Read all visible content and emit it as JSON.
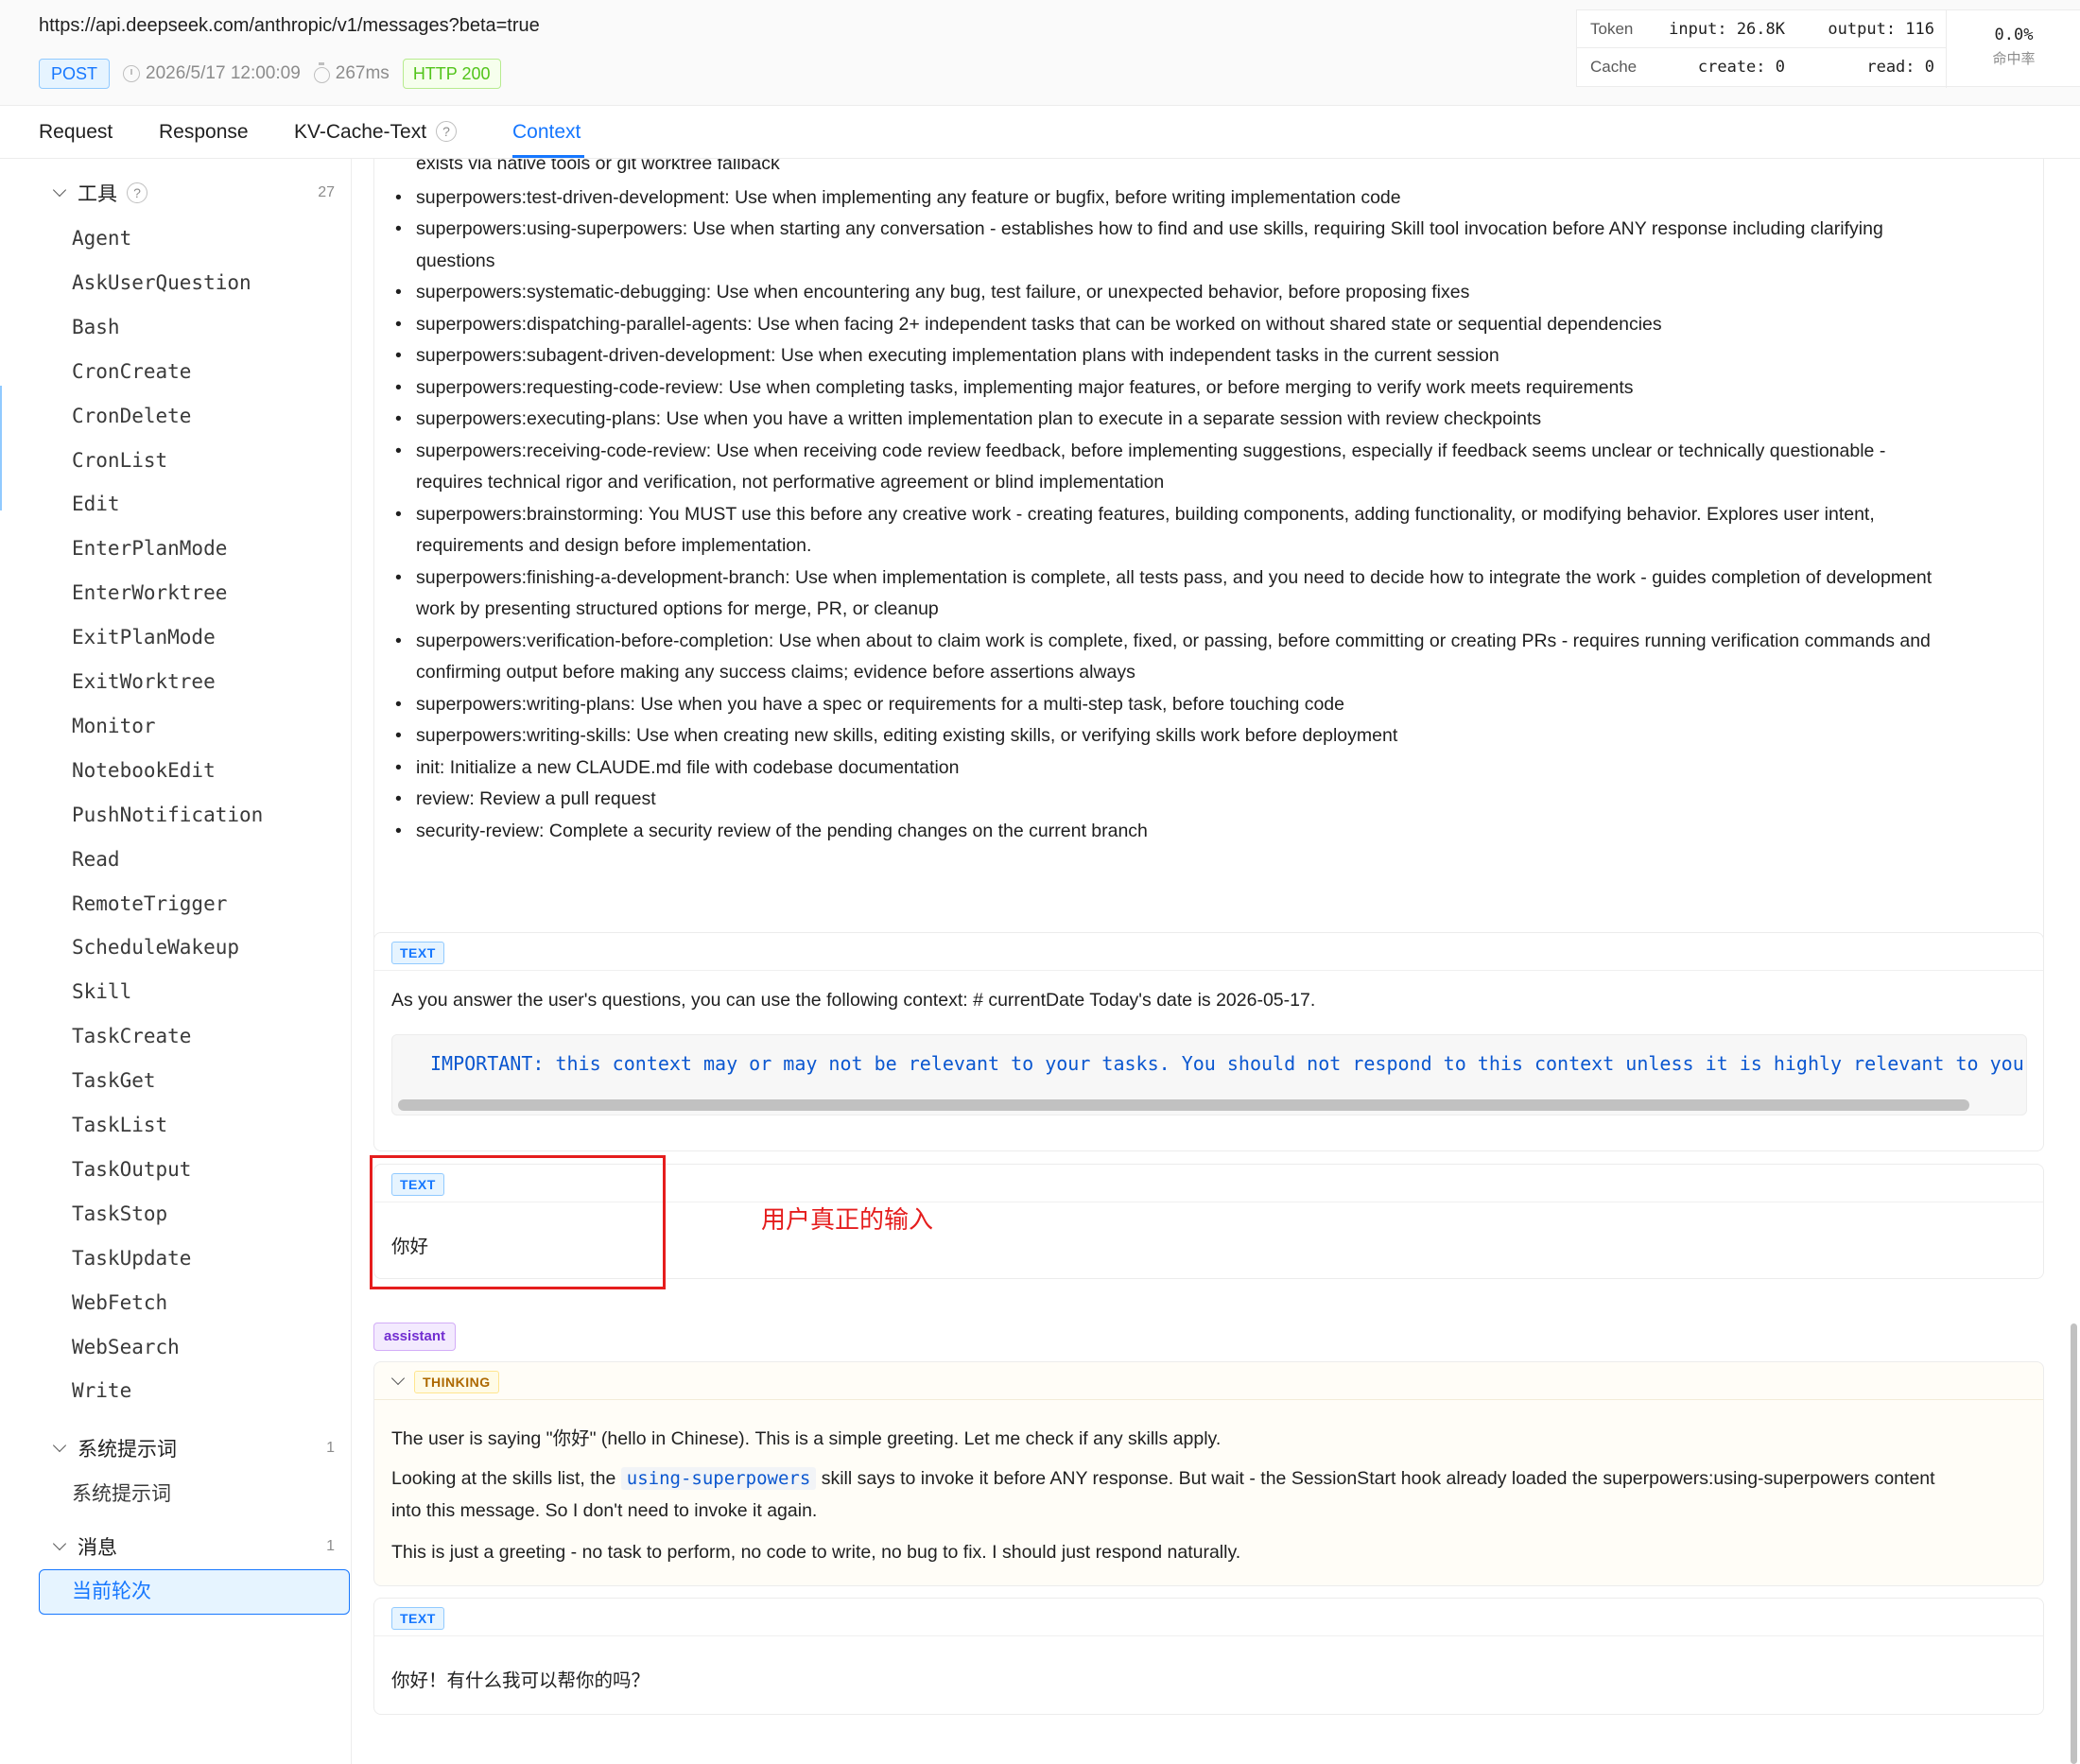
{
  "request": {
    "url": "https://api.deepseek.com/anthropic/v1/messages?beta=true",
    "method": "POST",
    "time": "2026/5/17 12:00:09",
    "duration": "267ms",
    "status": "HTTP 200"
  },
  "stats": {
    "token_label": "Token",
    "input": "input: 26.8K",
    "output": "output: 116",
    "cache_label": "Cache",
    "create": "create: 0",
    "read": "read: 0",
    "hit_rate": "0.0%",
    "hit_label": "命中率"
  },
  "tabs": [
    {
      "label": "Request"
    },
    {
      "label": "Response"
    },
    {
      "label": "KV-Cache-Text",
      "help": "?"
    },
    {
      "label": "Context",
      "active": true
    }
  ],
  "sidebar": {
    "tools": {
      "label": "工具",
      "help": "?",
      "count": "27",
      "items": [
        "Agent",
        "AskUserQuestion",
        "Bash",
        "CronCreate",
        "CronDelete",
        "CronList",
        "Edit",
        "EnterPlanMode",
        "EnterWorktree",
        "ExitPlanMode",
        "ExitWorktree",
        "Monitor",
        "NotebookEdit",
        "PushNotification",
        "Read",
        "RemoteTrigger",
        "ScheduleWakeup",
        "Skill",
        "TaskCreate",
        "TaskGet",
        "TaskList",
        "TaskOutput",
        "TaskStop",
        "TaskUpdate",
        "WebFetch",
        "WebSearch",
        "Write"
      ]
    },
    "system": {
      "label": "系统提示词",
      "count": "1",
      "items": [
        "系统提示词"
      ]
    },
    "messages": {
      "label": "消息",
      "count": "1",
      "items": [
        "当前轮次"
      ]
    }
  },
  "skills_list": [
    {
      "text": "exists via native tools or git worktree fallback",
      "continuation": true
    },
    {
      "text": "superpowers:test-driven-development: Use when implementing any feature or bugfix, before writing implementation code"
    },
    {
      "text": "superpowers:using-superpowers: Use when starting any conversation - establishes how to find and use skills, requiring Skill tool invocation before ANY response including clarifying"
    },
    {
      "text": "questions",
      "continuation": true
    },
    {
      "text": "superpowers:systematic-debugging: Use when encountering any bug, test failure, or unexpected behavior, before proposing fixes"
    },
    {
      "text": "superpowers:dispatching-parallel-agents: Use when facing 2+ independent tasks that can be worked on without shared state or sequential dependencies"
    },
    {
      "text": "superpowers:subagent-driven-development: Use when executing implementation plans with independent tasks in the current session"
    },
    {
      "text": "superpowers:requesting-code-review: Use when completing tasks, implementing major features, or before merging to verify work meets requirements"
    },
    {
      "text": "superpowers:executing-plans: Use when you have a written implementation plan to execute in a separate session with review checkpoints"
    },
    {
      "text": "superpowers:receiving-code-review: Use when receiving code review feedback, before implementing suggestions, especially if feedback seems unclear or technically questionable -"
    },
    {
      "text": "requires technical rigor and verification, not performative agreement or blind implementation",
      "continuation": true
    },
    {
      "text": "superpowers:brainstorming: You MUST use this before any creative work - creating features, building components, adding functionality, or modifying behavior. Explores user intent,"
    },
    {
      "text": "requirements and design before implementation.",
      "continuation": true
    },
    {
      "text": "superpowers:finishing-a-development-branch: Use when implementation is complete, all tests pass, and you need to decide how to integrate the work - guides completion of development"
    },
    {
      "text": "work by presenting structured options for merge, PR, or cleanup",
      "continuation": true
    },
    {
      "text": "superpowers:verification-before-completion: Use when about to claim work is complete, fixed, or passing, before committing or creating PRs - requires running verification commands and"
    },
    {
      "text": "confirming output before making any success claims; evidence before assertions always",
      "continuation": true
    },
    {
      "text": "superpowers:writing-plans: Use when you have a spec or requirements for a multi-step task, before touching code"
    },
    {
      "text": "superpowers:writing-skills: Use when creating new skills, editing existing skills, or verifying skills work before deployment"
    },
    {
      "text": "init: Initialize a new CLAUDE.md file with codebase documentation"
    },
    {
      "text": "review: Review a pull request"
    },
    {
      "text": "security-review: Complete a security review of the pending changes on the current branch"
    }
  ],
  "context_block": {
    "tag": "TEXT",
    "text": "As you answer the user's questions, you can use the following context: # currentDate Today's date is 2026-05-17.",
    "code": "IMPORTANT: this context may or may not be relevant to your tasks. You should not respond to this context unless it is highly relevant to your ta"
  },
  "user_block": {
    "tag": "TEXT",
    "text": "你好"
  },
  "annotation": "用户真正的输入",
  "assistant": {
    "role": "assistant",
    "thinking_tag": "THINKING",
    "thinking_p1": "The user is saying \"你好\" (hello in Chinese). This is a simple greeting. Let me check if any skills apply.",
    "thinking_p2_before": "Looking at the skills list, the",
    "thinking_p2_code": "using-superpowers",
    "thinking_p2_after": "skill says to invoke it before ANY response. But wait - the SessionStart hook already loaded the superpowers:using-superpowers content",
    "thinking_p2_line2": "into this message. So I don't need to invoke it again.",
    "thinking_p3": "This is just a greeting - no task to perform, no code to write, no bug to fix. I should just respond naturally.",
    "reply_tag": "TEXT",
    "reply": "你好！有什么我可以帮你的吗？"
  }
}
